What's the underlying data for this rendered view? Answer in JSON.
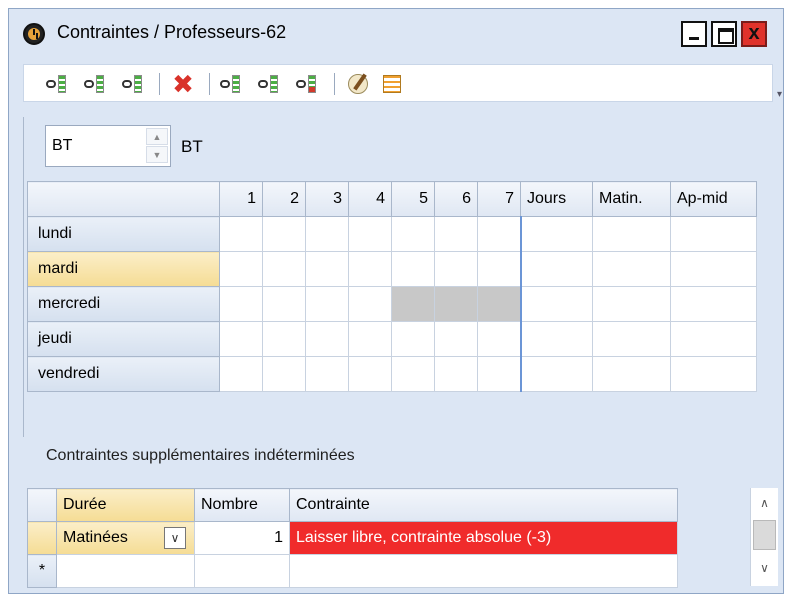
{
  "window": {
    "title": "Contraintes / Professeurs-62",
    "close_label": "x"
  },
  "toolbar": {
    "icons": [
      "chain-sheet-icon",
      "chain-sheet-icon",
      "chain-sheet-icon",
      "delete-x-icon",
      "chain-sheet-icon",
      "chain-sheet-icon",
      "chain-sheet-red-icon",
      "paint-brush-icon",
      "report-icon"
    ]
  },
  "selector": {
    "value": "BT",
    "label": "BT"
  },
  "grid": {
    "columns": [
      "1",
      "2",
      "3",
      "4",
      "5",
      "6",
      "7",
      "Jours",
      "Matin.",
      "Ap-mid"
    ],
    "rows": [
      {
        "day": "lundi",
        "selected": false,
        "gray": []
      },
      {
        "day": "mardi",
        "selected": true,
        "gray": []
      },
      {
        "day": "mercredi",
        "selected": false,
        "gray": [
          5,
          6,
          7
        ]
      },
      {
        "day": "jeudi",
        "selected": false,
        "gray": []
      },
      {
        "day": "vendredi",
        "selected": false,
        "gray": []
      }
    ]
  },
  "extra": {
    "label": "Contraintes supplémentaires indéterminées",
    "headers": {
      "duree": "Durée",
      "nombre": "Nombre",
      "contrainte": "Contrainte"
    },
    "row": {
      "duree": "Matinées",
      "nombre": "1",
      "contrainte": "Laisser libre, contrainte absolue (-3)"
    },
    "new_row_marker": "*"
  },
  "colors": {
    "window_bg": "#dce6f4",
    "selected_row": "#f5dc94",
    "unavailable": "#c8c8c8",
    "constraint_red": "#f02b2b",
    "close_button": "#e0322b"
  }
}
